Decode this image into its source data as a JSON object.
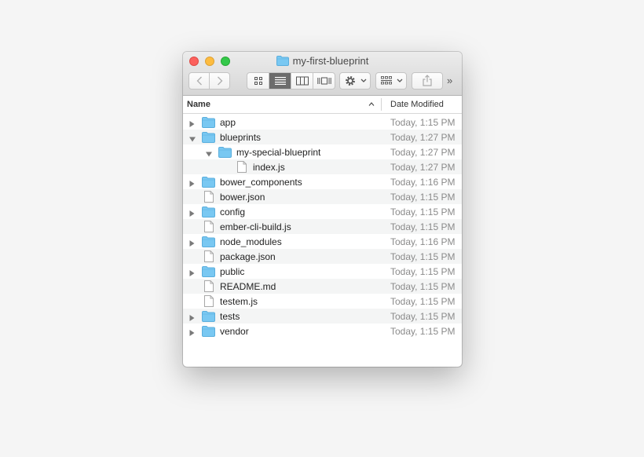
{
  "window": {
    "title": "my-first-blueprint"
  },
  "toolbar": {
    "back_icon": "chevron-left-icon",
    "forward_icon": "chevron-right-icon",
    "view_modes": [
      "icon-view",
      "list-view",
      "column-view",
      "cover-flow-view"
    ],
    "active_view": "list-view",
    "overflow_glyph": "»"
  },
  "columns": {
    "name": "Name",
    "date": "Date Modified"
  },
  "files": [
    {
      "name": "app",
      "date": "Today, 1:15 PM",
      "type": "folder",
      "level": 0,
      "expanded": false
    },
    {
      "name": "blueprints",
      "date": "Today, 1:27 PM",
      "type": "folder",
      "level": 0,
      "expanded": true
    },
    {
      "name": "my-special-blueprint",
      "date": "Today, 1:27 PM",
      "type": "folder",
      "level": 1,
      "expanded": true
    },
    {
      "name": "index.js",
      "date": "Today, 1:27 PM",
      "type": "file",
      "level": 2
    },
    {
      "name": "bower_components",
      "date": "Today, 1:16 PM",
      "type": "folder",
      "level": 0,
      "expanded": false
    },
    {
      "name": "bower.json",
      "date": "Today, 1:15 PM",
      "type": "file",
      "level": 0
    },
    {
      "name": "config",
      "date": "Today, 1:15 PM",
      "type": "folder",
      "level": 0,
      "expanded": false
    },
    {
      "name": "ember-cli-build.js",
      "date": "Today, 1:15 PM",
      "type": "file",
      "level": 0
    },
    {
      "name": "node_modules",
      "date": "Today, 1:16 PM",
      "type": "folder",
      "level": 0,
      "expanded": false
    },
    {
      "name": "package.json",
      "date": "Today, 1:15 PM",
      "type": "file",
      "level": 0
    },
    {
      "name": "public",
      "date": "Today, 1:15 PM",
      "type": "folder",
      "level": 0,
      "expanded": false
    },
    {
      "name": "README.md",
      "date": "Today, 1:15 PM",
      "type": "file",
      "level": 0
    },
    {
      "name": "testem.js",
      "date": "Today, 1:15 PM",
      "type": "file",
      "level": 0
    },
    {
      "name": "tests",
      "date": "Today, 1:15 PM",
      "type": "folder",
      "level": 0,
      "expanded": false
    },
    {
      "name": "vendor",
      "date": "Today, 1:15 PM",
      "type": "folder",
      "level": 0,
      "expanded": false
    }
  ],
  "colors": {
    "folder": "#79c8f2",
    "folder_edge": "#5aaedd",
    "close": "#fc615d",
    "minimize": "#fdbc40",
    "maximize": "#34c84a"
  }
}
